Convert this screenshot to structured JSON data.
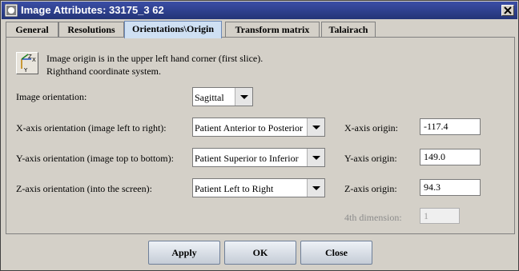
{
  "window": {
    "title": "Image Attributes: 33175_3 62"
  },
  "tabs": [
    {
      "label": "General"
    },
    {
      "label": "Resolutions"
    },
    {
      "label": "Orientations\\Origin"
    },
    {
      "label": "Transform matrix"
    },
    {
      "label": "Talairach"
    }
  ],
  "active_tab": "Orientations\\Origin",
  "info": {
    "line1": "Image origin is in the upper left hand corner (first slice).",
    "line2": "Righthand coordinate system."
  },
  "image_orientation": {
    "label": "Image orientation:",
    "value": "Sagittal"
  },
  "axes": [
    {
      "label": "X-axis orientation (image left to right):",
      "value": "Patient Anterior to Posterior",
      "origin_label": "X-axis origin:",
      "origin_value": "-117.4"
    },
    {
      "label": "Y-axis orientation (image top to bottom):",
      "value": "Patient Superior to Inferior",
      "origin_label": "Y-axis origin:",
      "origin_value": "149.0"
    },
    {
      "label": "Z-axis orientation (into the screen):",
      "value": "Patient Left to Right",
      "origin_label": "Z-axis origin:",
      "origin_value": "94.3"
    }
  ],
  "fourth_dimension": {
    "label": "4th dimension:",
    "value": "1"
  },
  "buttons": {
    "apply": "Apply",
    "ok": "OK",
    "close": "Close"
  }
}
